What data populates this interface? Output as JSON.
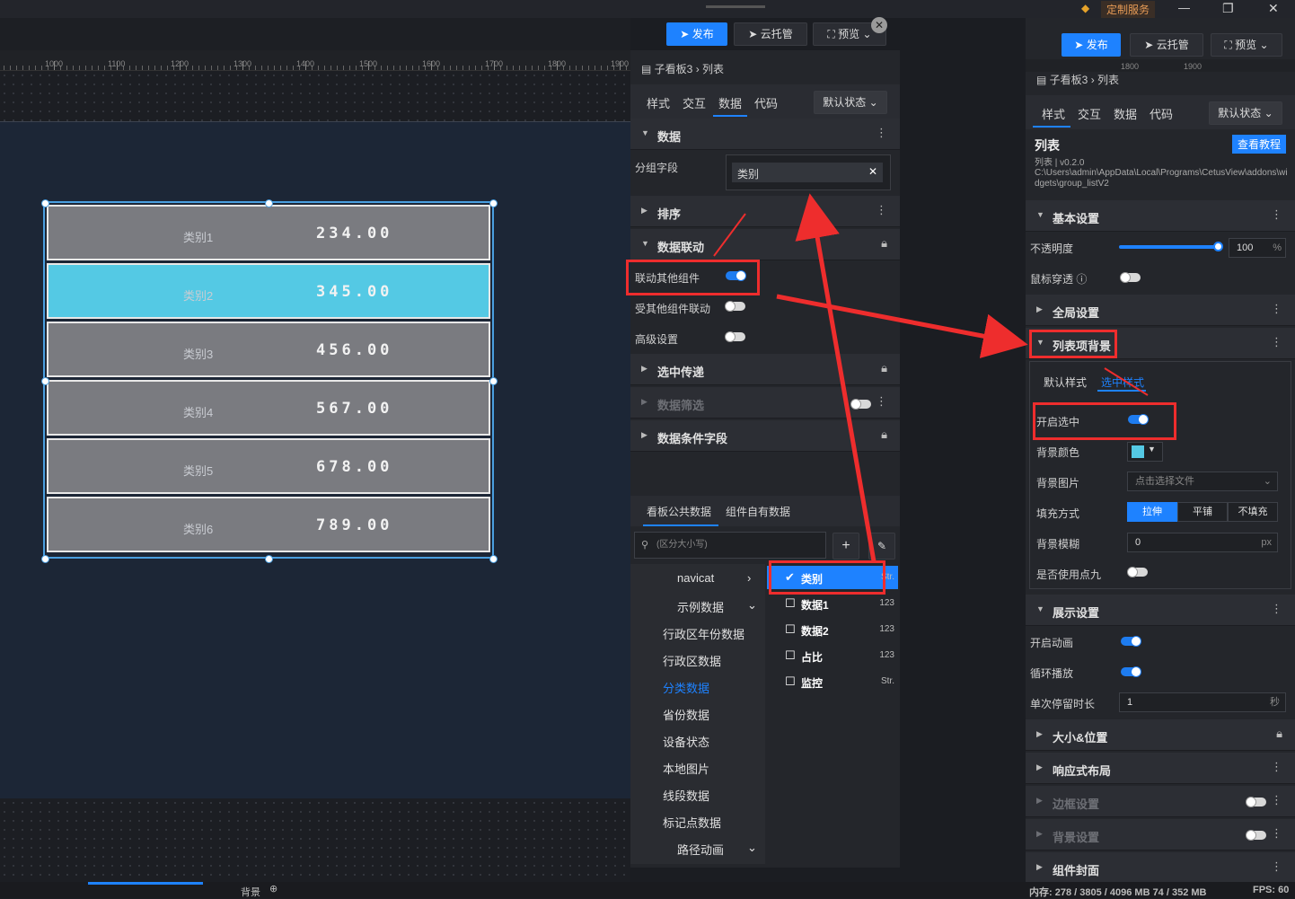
{
  "window": {
    "custom_service": "定制服务",
    "minimize": "—",
    "restore": "❐",
    "close": "✕"
  },
  "toolbar": {
    "publish": "发布",
    "cloud_host": "云托管",
    "preview": "预览"
  },
  "ruler": {
    "labels": [
      "1000",
      "1100",
      "1200",
      "1300",
      "1400",
      "1500",
      "1600",
      "1700",
      "1800",
      "1900"
    ],
    "right_labels": [
      "1800",
      "1900"
    ]
  },
  "list_widget": {
    "rows": [
      {
        "category": "类别1",
        "value": "234.00"
      },
      {
        "category": "类别2",
        "value": "345.00"
      },
      {
        "category": "类别3",
        "value": "456.00"
      },
      {
        "category": "类别4",
        "value": "567.00"
      },
      {
        "category": "类别5",
        "value": "678.00"
      },
      {
        "category": "类别6",
        "value": "789.00"
      }
    ],
    "selected_index": 1
  },
  "mid_panel": {
    "breadcrumb_parent": "子看板3",
    "breadcrumb_child": "列表",
    "tabs": [
      "样式",
      "交互",
      "数据",
      "代码"
    ],
    "active_tab": "数据",
    "state_select": "默认状态",
    "sections": {
      "data": "数据",
      "group_field_label": "分组字段",
      "group_field_value": "类别",
      "sort": "排序",
      "linkage": "数据联动",
      "link_others": "联动其他组件",
      "linked_by_others": "受其他组件联动",
      "advanced": "高级设置",
      "selected_pass": "选中传递",
      "data_filter": "数据筛选",
      "data_condition": "数据条件字段"
    },
    "toggles": {
      "link_others": true,
      "linked_by_others": false,
      "advanced": false
    },
    "data_tabs": [
      "看板公共数据",
      "组件自有数据"
    ],
    "search_placeholder": "(区分大小写)",
    "sources": [
      "navicat",
      "示例数据",
      "行政区年份数据",
      "行政区数据",
      "分类数据",
      "省份数据",
      "设备状态",
      "本地图片",
      "线段数据",
      "标记点数据",
      "路径动画"
    ],
    "active_source": "分类数据",
    "fields": [
      {
        "name": "类别",
        "type": "Str.",
        "checked": true
      },
      {
        "name": "数据1",
        "type": "123",
        "checked": false
      },
      {
        "name": "数据2",
        "type": "123",
        "checked": false
      },
      {
        "name": "占比",
        "type": "123",
        "checked": false
      },
      {
        "name": "监控",
        "type": "Str.",
        "checked": false
      }
    ]
  },
  "right_panel": {
    "breadcrumb_parent": "子看板3",
    "breadcrumb_child": "列表",
    "tabs": [
      "样式",
      "交互",
      "数据",
      "代码"
    ],
    "active_tab": "样式",
    "state_select": "默认状态",
    "component_title": "列表",
    "version": "列表 | v0.2.0",
    "path": "C:\\Users\\admin\\AppData\\Local\\Programs\\CetusView\\addons\\widgets\\group_listV2",
    "tutorial_button": "查看教程",
    "basic_settings": "基本设置",
    "opacity_label": "不透明度",
    "opacity_value": "100",
    "opacity_unit": "%",
    "opacity_level": 1.0,
    "mouse_through": "鼠标穿透",
    "global_settings": "全局设置",
    "list_bg": "列表项背景",
    "subtabs": [
      "默认样式",
      "选中样式"
    ],
    "active_subtab": "选中样式",
    "enable_select": "开启选中",
    "bg_color_label": "背景颜色",
    "bg_color": "#54c9e4",
    "bg_image_label": "背景图片",
    "bg_image_placeholder": "点击选择文件",
    "fill_mode_label": "填充方式",
    "fill_modes": [
      "拉伸",
      "平铺",
      "不填充"
    ],
    "active_fill": "拉伸",
    "bg_blur_label": "背景模糊",
    "bg_blur_value": "0",
    "bg_blur_unit": "px",
    "nine_slice_label": "是否使用点九",
    "display_settings": "展示设置",
    "enable_animation": "开启动画",
    "loop_play": "循环播放",
    "dwell_label": "单次停留时长",
    "dwell_value": "1",
    "dwell_unit": "秒",
    "size_position": "大小&位置",
    "responsive": "响应式布局",
    "border_settings": "边框设置",
    "bg_settings": "背景设置",
    "cover": "组件封面"
  },
  "status": {
    "memory": "内存: 278 / 3805 / 4096 MB  74 / 352 MB",
    "fps": "FPS: 60",
    "tab_bg": "背景"
  }
}
